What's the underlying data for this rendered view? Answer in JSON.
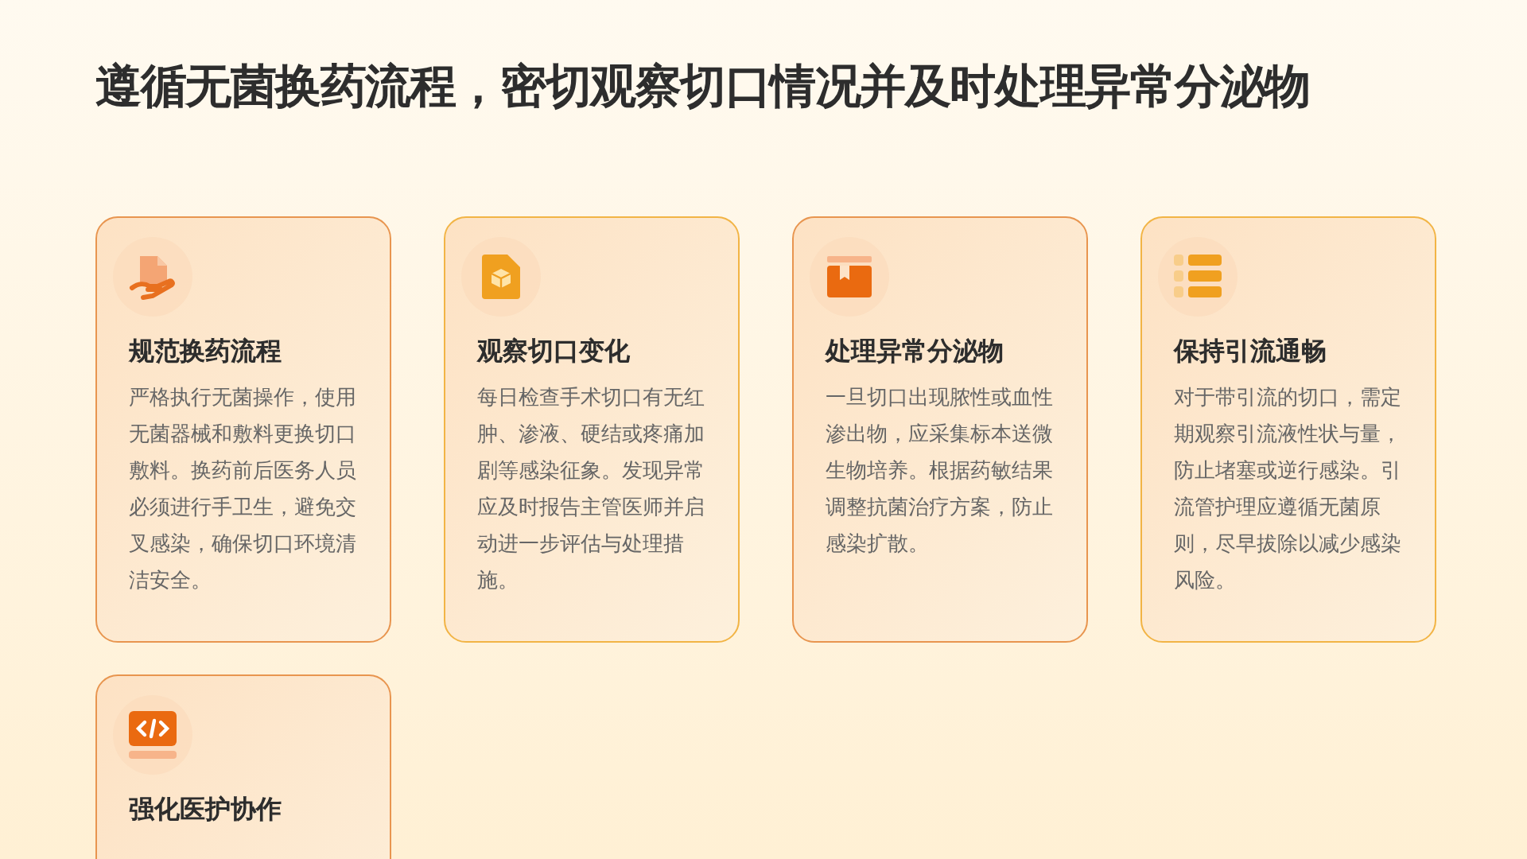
{
  "title": "遵循无菌换药流程，密切观察切口情况并及时处理异常分泌物",
  "cards": [
    {
      "color": "#e8954f",
      "heading": "规范换药流程",
      "body": "严格执行无菌操作，使用无菌器械和敷料更换切口敷料。换药前后医务人员必须进行手卫生，避免交叉感染，确保切口环境清洁安全。"
    },
    {
      "color": "#f2b445",
      "heading": "观察切口变化",
      "body": "每日检查手术切口有无红肿、渗液、硬结或疼痛加剧等感染征象。发现异常应及时报告主管医师并启动进一步评估与处理措施。"
    },
    {
      "color": "#e8954f",
      "heading": "处理异常分泌物",
      "body": "一旦切口出现脓性或血性渗出物，应采集标本送微生物培养。根据药敏结果调整抗菌治疗方案，防止感染扩散。"
    },
    {
      "color": "#f2b445",
      "heading": "保持引流通畅",
      "body": "对于带引流的切口，需定期观察引流液性状与量，防止堵塞或逆行感染。引流管护理应遵循无菌原则，尽早拔除以减少感染风险。"
    },
    {
      "color": "#e8954f",
      "heading": "强化医护协作"
    }
  ]
}
